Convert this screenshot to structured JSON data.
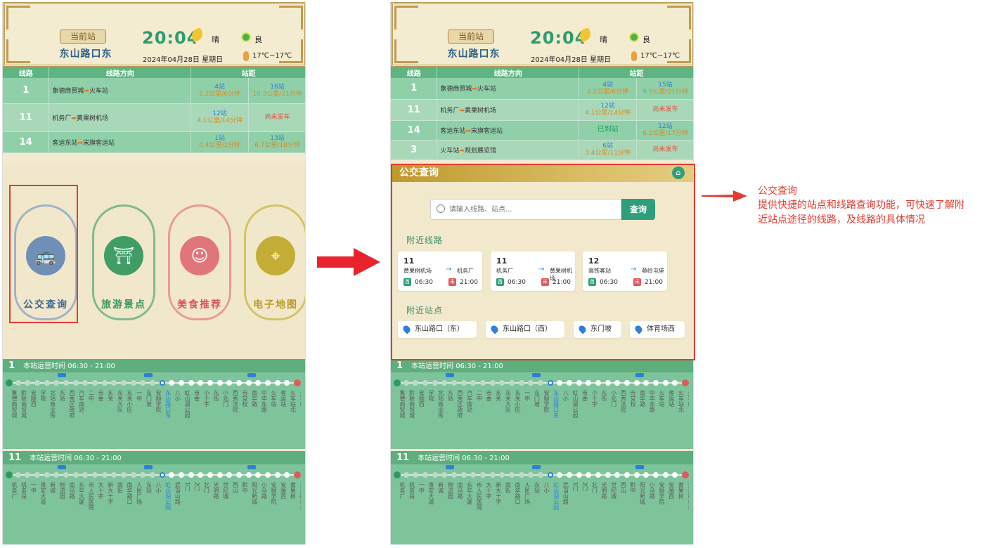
{
  "header": {
    "current_label": "当前站",
    "station": "东山路口东",
    "time": "20:04",
    "weather": "晴",
    "aqi": "良",
    "date": "2024年04月28日 星期日",
    "temp": "17℃~17℃"
  },
  "table": {
    "headers": [
      "线路",
      "线路方向",
      "站距"
    ],
    "left_rows": [
      {
        "num": "1",
        "from": "象德商贸城",
        "to": "火车站",
        "d1a": "4站",
        "d1b": "2.2公里/6分钟",
        "d2a": "16站",
        "d2b": "10.3公里/21分钟",
        "d2_state": ""
      },
      {
        "num": "11",
        "from": "机务厂",
        "to": "黄果树机场",
        "d1a": "12站",
        "d1b": "4.1公里/14分钟",
        "d2a": "",
        "d2b": "",
        "d2_state": "尚未发车"
      },
      {
        "num": "14",
        "from": "客运东站",
        "to": "宋旗客运站",
        "d1a": "1站",
        "d1b": "0.4公里/1分钟",
        "d2a": "13站",
        "d2b": "6.7公里/18分钟",
        "d2_state": ""
      }
    ],
    "right_rows": [
      {
        "num": "1",
        "from": "象德商贸城",
        "to": "火车站",
        "d1a": "4站",
        "d1b": "2.2公里/6分钟",
        "d1_state": "",
        "d2a": "15站",
        "d2b": "9.9公里/21分钟",
        "d2_state": ""
      },
      {
        "num": "11",
        "from": "机务厂",
        "to": "黄果树机场",
        "d1a": "12站",
        "d1b": "4.1公里/14分钟",
        "d1_state": "",
        "d2a": "",
        "d2b": "",
        "d2_state": "尚未发车"
      },
      {
        "num": "14",
        "from": "客运东站",
        "to": "宋旗客运站",
        "d1a": "",
        "d1b": "",
        "d1_state": "已到站",
        "d2a": "12站",
        "d2b": "6.2公里/17分钟",
        "d2_state": ""
      },
      {
        "num": "3",
        "from": "火车站",
        "to": "规划展览馆",
        "d1a": "6站",
        "d1b": "3.4公里/11分钟",
        "d1_state": "",
        "d2a": "",
        "d2b": "",
        "d2_state": "尚未发车"
      }
    ]
  },
  "features": [
    "公交查询",
    "旅游景点",
    "美食推荐",
    "电子地图"
  ],
  "strip1": {
    "num": "1",
    "hours_label": "本站运营时间",
    "hours": "06:30 - 21:00",
    "stops": [
      "象德商贸城",
      "黔联商贸城",
      "安顺西",
      "学院",
      "北站商业街",
      "东站",
      "西秀区政府",
      "汽车南站",
      "二中",
      "市委",
      "东关",
      "东关大队",
      "东关小区",
      "一中",
      "东门坡",
      "安顺学院",
      "东山路口东",
      "八小",
      "虹山湖公园",
      "市委",
      "小十字",
      "东街",
      "小北门",
      "西秀法院",
      "市党校",
      "南华路",
      "中华东路",
      "火车站",
      "客运站",
      "火车站北",
      "火车站"
    ]
  },
  "strip2": {
    "num": "11",
    "hours_label": "本站运营时间",
    "hours": "06:30 - 21:00",
    "stops": [
      "机务厂",
      "机务段",
      "一中",
      "贵安大道",
      "新城",
      "物流园",
      "南马路",
      "东华大厦",
      "市人民医院",
      "大十字",
      "新大十字",
      "南街",
      "南华路口",
      "人民广场",
      "东站",
      "八小",
      "虹山湖公园",
      "武当山路",
      "1门",
      "2门",
      "北门",
      "光明路",
      "世纪城",
      "西山",
      "黔中",
      "阳光新城",
      "小马路",
      "安顺学院",
      "安顺西",
      "黄果树",
      "黄果树机场"
    ]
  },
  "search": {
    "title": "公交查询",
    "placeholder": "请输入线路、站点...",
    "button": "查询",
    "nearby_lines_label": "附近线路",
    "nearby_stops_label": "附近站点",
    "lines": [
      {
        "no": "11",
        "from": "黄果树机场",
        "to": "机务厂",
        "first_tag": "首",
        "first": "06:30",
        "last_tag": "末",
        "last": "21:00"
      },
      {
        "no": "11",
        "from": "机务厂",
        "to": "黄果树机场",
        "first_tag": "首",
        "first": "06:30",
        "last_tag": "末",
        "last": "21:00"
      },
      {
        "no": "12",
        "from": "高铁客站",
        "to": "蔡岭屯堡",
        "first_tag": "首",
        "first": "06:30",
        "last_tag": "末",
        "last": "21:00"
      }
    ],
    "stops": [
      "东山路口（东）",
      "东山路口（西）",
      "东门坡",
      "体育场西"
    ]
  },
  "annotation": {
    "title": "公交查询",
    "desc": "提供快捷的站点和线路查询功能，可快速了解附近站点途径的线路，及线路的具体情况"
  },
  "colors": {
    "accent": "#2f9e7c",
    "highlight": "#e33b30",
    "header_green": "#5fb582"
  }
}
